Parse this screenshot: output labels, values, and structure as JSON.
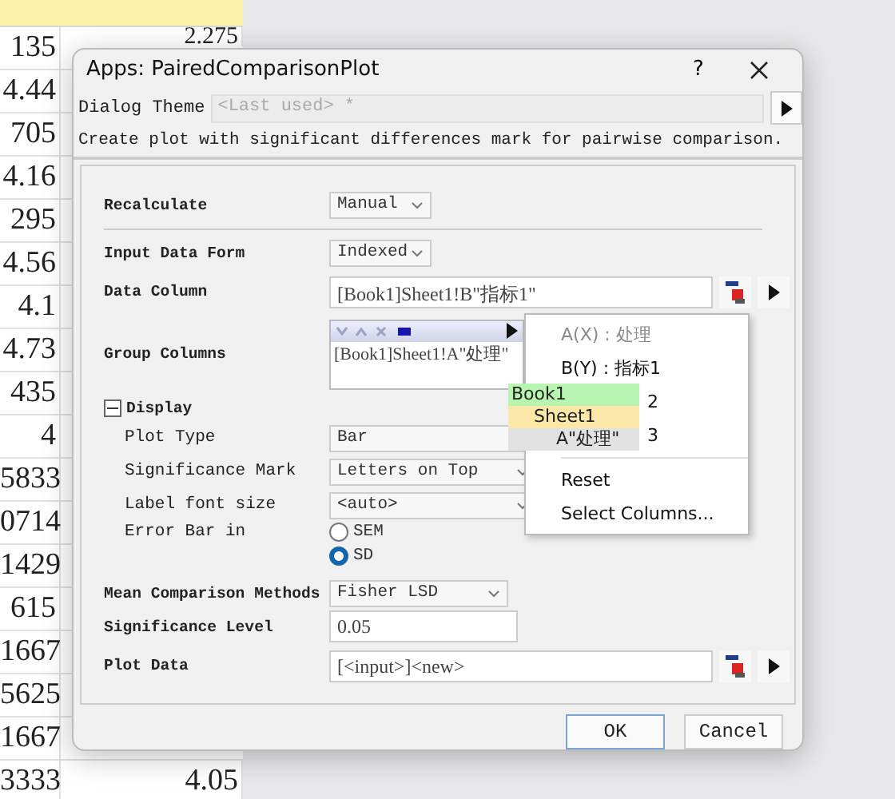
{
  "spreadsheet": {
    "rows": [
      {
        "col_1": "135",
        "col_2": "2.275"
      },
      {
        "col_1": "4.44"
      },
      {
        "col_1": "705"
      },
      {
        "col_1": "4.16"
      },
      {
        "col_1": "295"
      },
      {
        "col_1": "4.56"
      },
      {
        "col_1": "4.1"
      },
      {
        "col_1": "4.73"
      },
      {
        "col_1": "435"
      },
      {
        "col_1": "4"
      },
      {
        "col_1": "5833"
      },
      {
        "col_1": "0714"
      },
      {
        "col_1": "1429"
      },
      {
        "col_1": "615"
      },
      {
        "col_1": "1667"
      },
      {
        "col_1": "5625"
      },
      {
        "col_1": "1667"
      },
      {
        "col_1": "3333",
        "col_2": "4.05"
      }
    ]
  },
  "dialog": {
    "title": "Apps: PairedComparisonPlot",
    "help_button": "?",
    "theme": {
      "label": "Dialog Theme",
      "value": "<Last used> *"
    },
    "description": "Create plot with significant differences mark for pairwise comparison.",
    "fields": [
      {
        "kind": "dropdown",
        "label": "Recalculate",
        "value": "Manual"
      },
      {
        "kind": "divider"
      },
      {
        "kind": "dropdown",
        "label": "Input Data Form",
        "value": "Indexed"
      },
      {
        "kind": "column",
        "label": "Data Column",
        "value": "[Book1]Sheet1!B\"指标1\""
      },
      {
        "kind": "group",
        "label": "Group Columns",
        "value": "[Book1]Sheet1!A\"处理\""
      },
      {
        "kind": "section",
        "label": "Display",
        "expanded": true,
        "children": [
          {
            "kind": "dropdown",
            "label": "Plot Type",
            "value": "Bar"
          },
          {
            "kind": "dropdown",
            "label": "Significance Mark",
            "value": "Letters on Top"
          },
          {
            "kind": "dropdown",
            "label": "Label font size",
            "value": "<auto>"
          },
          {
            "kind": "radio",
            "label": "Error Bar in",
            "options": [
              {
                "label": "SEM",
                "selected": false
              },
              {
                "label": "SD",
                "selected": true
              }
            ]
          }
        ]
      },
      {
        "kind": "dropdown",
        "label": "Mean Comparison Methods",
        "value": "Fisher LSD"
      },
      {
        "kind": "text",
        "label": "Significance Level",
        "value": "0.05"
      },
      {
        "kind": "column",
        "label": "Plot Data",
        "value": "[<input>]<new>"
      }
    ],
    "buttons": [
      "OK",
      "Cancel"
    ]
  },
  "context_menu": {
    "items": [
      {
        "kind": "item",
        "label": "A(X) : 处理",
        "disabled": true
      },
      {
        "kind": "item",
        "label": "B(Y) : 指标1",
        "disabled": false
      },
      {
        "kind": "covered",
        "label": "2",
        "disabled": false
      },
      {
        "kind": "covered",
        "label": "3",
        "disabled": false
      },
      {
        "kind": "separator"
      },
      {
        "kind": "item",
        "label": "Reset",
        "disabled": false
      },
      {
        "kind": "item",
        "label": "Select Columns...",
        "disabled": false
      }
    ]
  },
  "submenu": {
    "items": [
      {
        "label": "Book1",
        "color": "#b8f5b0"
      },
      {
        "label": "Sheet1",
        "color": "#fbe7a8"
      },
      {
        "label": "A\"处理\"",
        "color": "#e2e2e2"
      }
    ]
  }
}
